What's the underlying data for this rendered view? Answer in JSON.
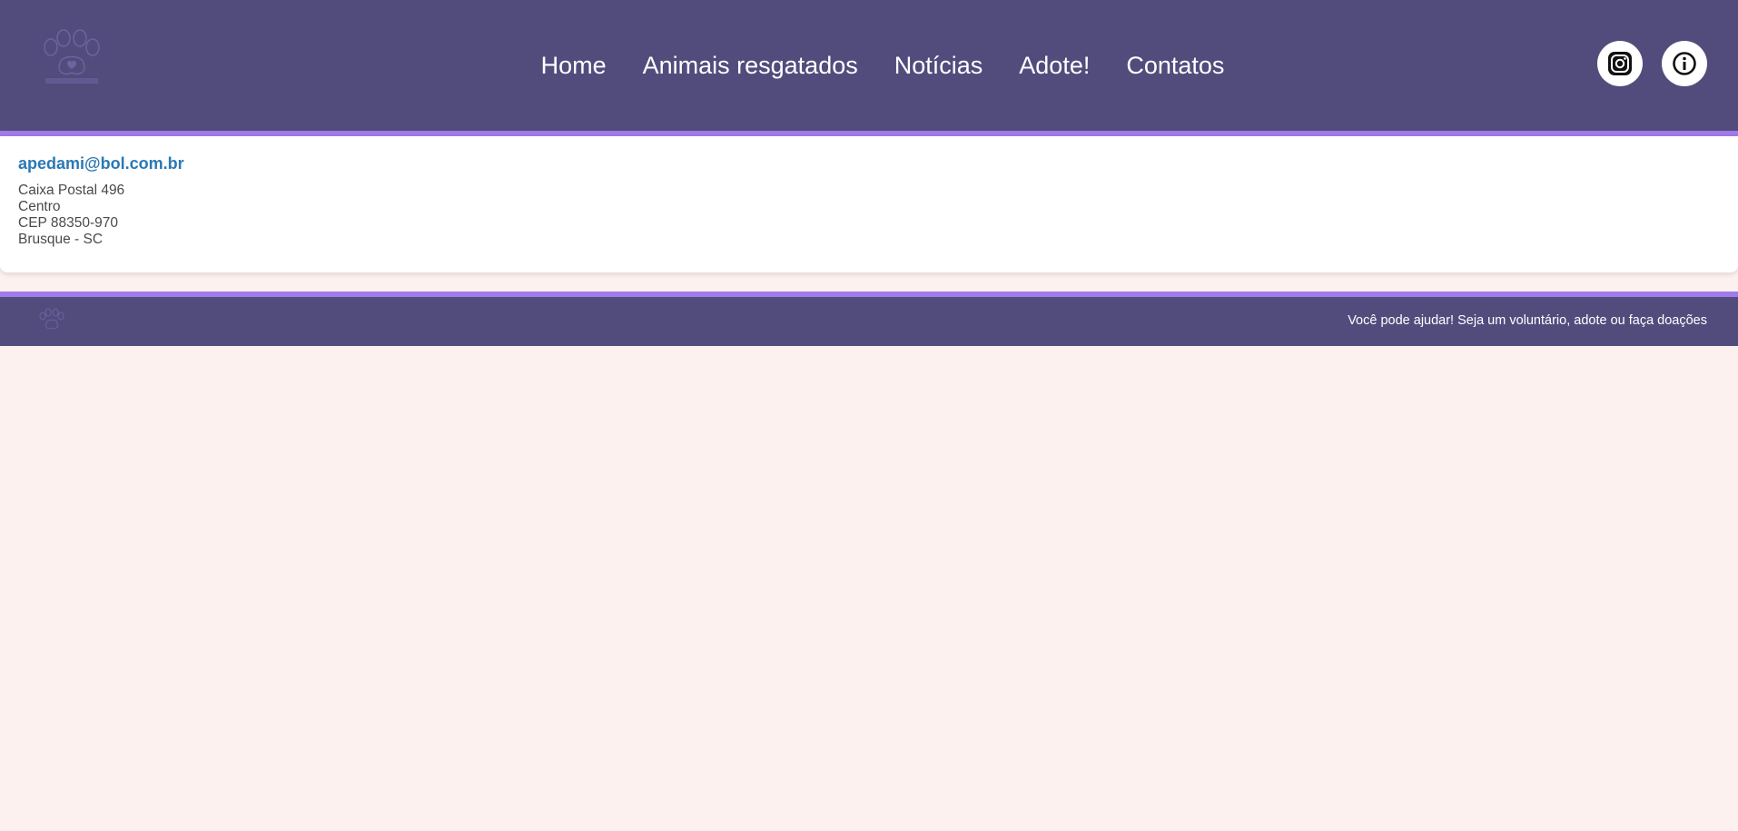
{
  "header": {
    "nav": [
      {
        "label": "Home"
      },
      {
        "label": "Animais resgatados"
      },
      {
        "label": "Notícias"
      },
      {
        "label": "Adote!"
      },
      {
        "label": "Contatos"
      }
    ],
    "social": [
      "instagram-icon",
      "info-icon"
    ]
  },
  "contact": {
    "email": "apedami@bol.com.br",
    "address": [
      "Caixa Postal 496",
      "Centro",
      "CEP 88350-970",
      "Brusque - SC"
    ]
  },
  "footer": {
    "text": "Você pode ajudar! Seja um voluntário, adote ou faça doações"
  },
  "colors": {
    "header_bg": "#524c7d",
    "accent": "#a07ae8",
    "page_bg": "#fdf1f0",
    "link": "#2a78b4"
  }
}
